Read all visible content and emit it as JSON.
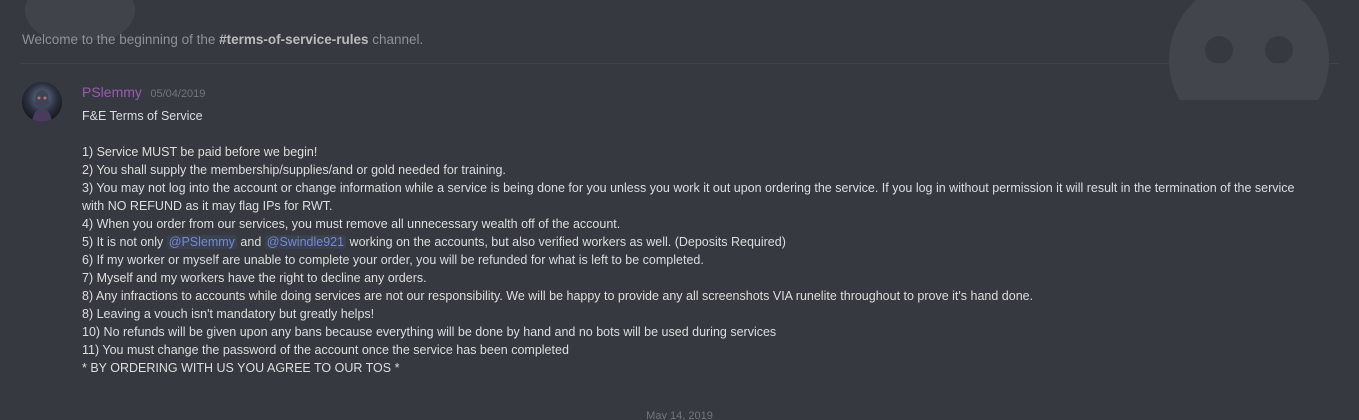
{
  "welcome": {
    "prefix": "Welcome to the beginning of the ",
    "channel": "#terms-of-service-rules",
    "suffix": " channel."
  },
  "message": {
    "author": "PSlemmy",
    "timestamp": "05/04/2019",
    "title": "F&E Terms of Service",
    "rules": {
      "r1": "1) Service MUST be paid before we begin!",
      "r2": "2) You shall supply the membership/supplies/and or gold needed for training.",
      "r3": "3) You may not log into the account or change information while a service is being done for you unless you work it out upon ordering the service. If you log in without permission it will result in the termination of the service with NO REFUND as it may flag IPs for RWT.",
      "r4": "4) When you order from our services, you must remove all unnecessary wealth off of the account.",
      "r5_prefix": "5) It is not only ",
      "r5_mention1": "@PSlemmy",
      "r5_and": " and ",
      "r5_mention2": "@Swindle921",
      "r5_suffix": " working on the accounts, but also verified workers as well. (Deposits Required)",
      "r6": "6) If my worker or myself are unable to complete your order, you will be refunded for what is left to be completed.",
      "r7": "7) Myself and my workers have the right to decline any orders.",
      "r8a": "8) Any infractions to accounts while doing services are not our responsibility. We will be happy to provide any all screenshots VIA runelite throughout to prove it's hand done.",
      "r8b": "8) Leaving a vouch isn't mandatory but greatly helps!",
      "r10": "10) No refunds will be given upon any bans because everything will be done by hand and no bots will be used during services",
      "r11": "11) You must change the password of the account once the service has been completed",
      "closing": "* BY ORDERING WITH US YOU AGREE TO OUR TOS *"
    }
  },
  "date_divider": "May 14, 2019",
  "colors": {
    "background": "#36393f",
    "author": "#9b59b6",
    "mention": "#7289da",
    "text": "#dcddde"
  }
}
